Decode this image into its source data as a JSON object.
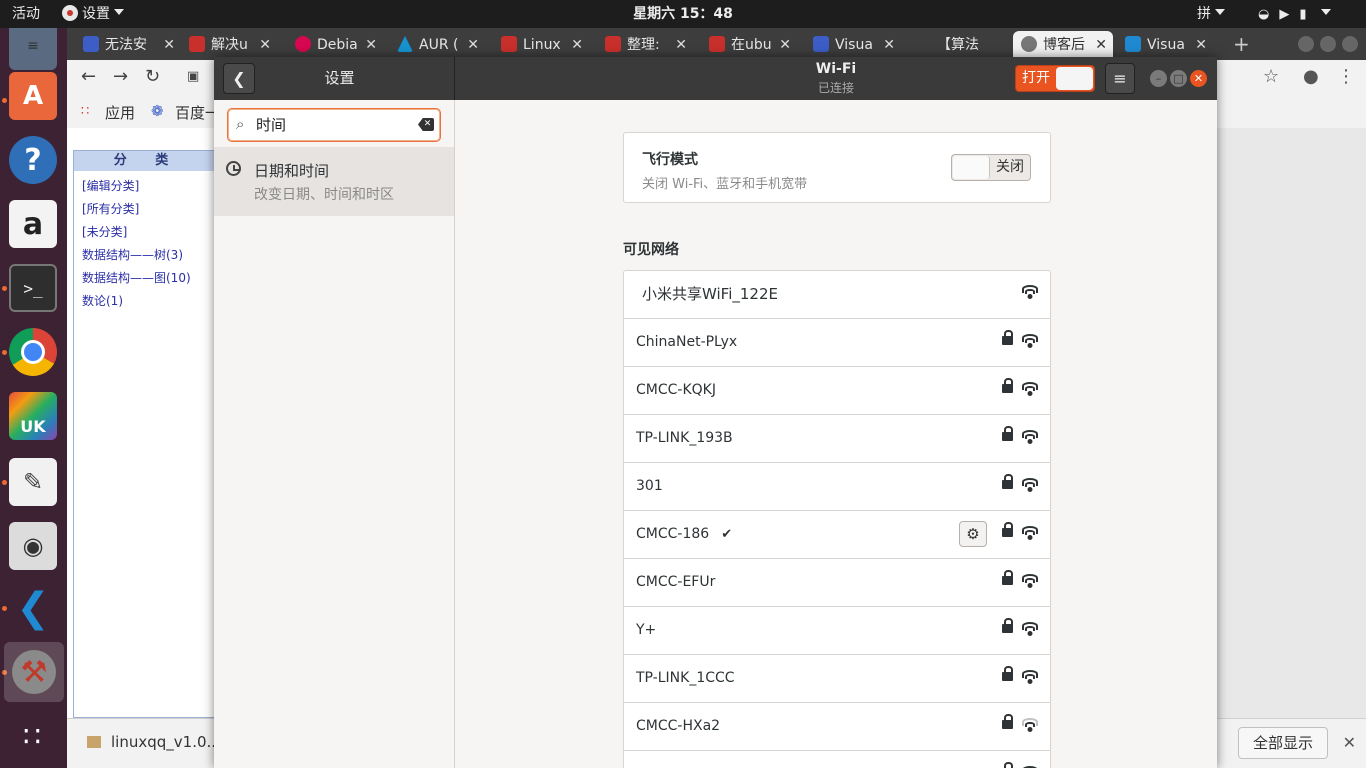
{
  "topbar": {
    "activities": "活动",
    "app_menu": "设置",
    "clock": "星期六 15：48",
    "input_method": "拼"
  },
  "launcher": {
    "items": [
      "files-icon",
      "software-center-icon",
      "help-icon",
      "amazon-icon",
      "terminal-icon",
      "chrome-icon",
      "ukylin-icon",
      "text-editor-icon",
      "camera-icon",
      "vscode-icon",
      "settings-icon",
      "app-grid-icon"
    ]
  },
  "browser": {
    "tabs": [
      {
        "label": "无法安"
      },
      {
        "label": "解决u"
      },
      {
        "label": "Debia"
      },
      {
        "label": "AUR ("
      },
      {
        "label": "Linux"
      },
      {
        "label": "整理:"
      },
      {
        "label": "在ubu"
      },
      {
        "label": "Visua"
      },
      {
        "label": "【算法"
      },
      {
        "label": "博客后"
      },
      {
        "label": "Visua"
      }
    ],
    "bookmarks": {
      "apps": "应用",
      "baidu": "百度一"
    },
    "category_panel": {
      "header": "分 类",
      "links": [
        "[编辑分类]",
        "[所有分类]",
        "[未分类]",
        "数据结构——树(3)",
        "数据结构——图(10)",
        "数论(1)"
      ]
    },
    "download": {
      "file": "linuxqq_v1.0...",
      "show_all": "全部显示"
    }
  },
  "settings": {
    "title": "设置",
    "search": {
      "value": "时间"
    },
    "result": {
      "title": "日期和时间",
      "desc": "改变日期、时间和时区"
    },
    "panel": {
      "title": "Wi-Fi",
      "subtitle": "已连接",
      "switch_label": "打开"
    },
    "airplane": {
      "title": "飞行模式",
      "desc": "关闭 Wi-Fi、蓝牙和手机宽带",
      "switch_label": "关闭"
    },
    "visible_networks": "可见网络",
    "networks": [
      {
        "name": "小米共享WiFi_122E",
        "secured": false,
        "connected": false
      },
      {
        "name": "ChinaNet-PLyx",
        "secured": true,
        "connected": false
      },
      {
        "name": "CMCC-KQKJ",
        "secured": true,
        "connected": false
      },
      {
        "name": "TP-LINK_193B",
        "secured": true,
        "connected": false
      },
      {
        "name": "301",
        "secured": true,
        "connected": false
      },
      {
        "name": "CMCC-186",
        "secured": true,
        "connected": true
      },
      {
        "name": "CMCC-EFUr",
        "secured": true,
        "connected": false
      },
      {
        "name": "Y+",
        "secured": true,
        "connected": false
      },
      {
        "name": "TP-LINK_1CCC",
        "secured": true,
        "connected": false
      },
      {
        "name": "CMCC-HXa2",
        "secured": true,
        "connected": false,
        "weak": true
      },
      {
        "name": "",
        "secured": true,
        "connected": false
      }
    ]
  }
}
